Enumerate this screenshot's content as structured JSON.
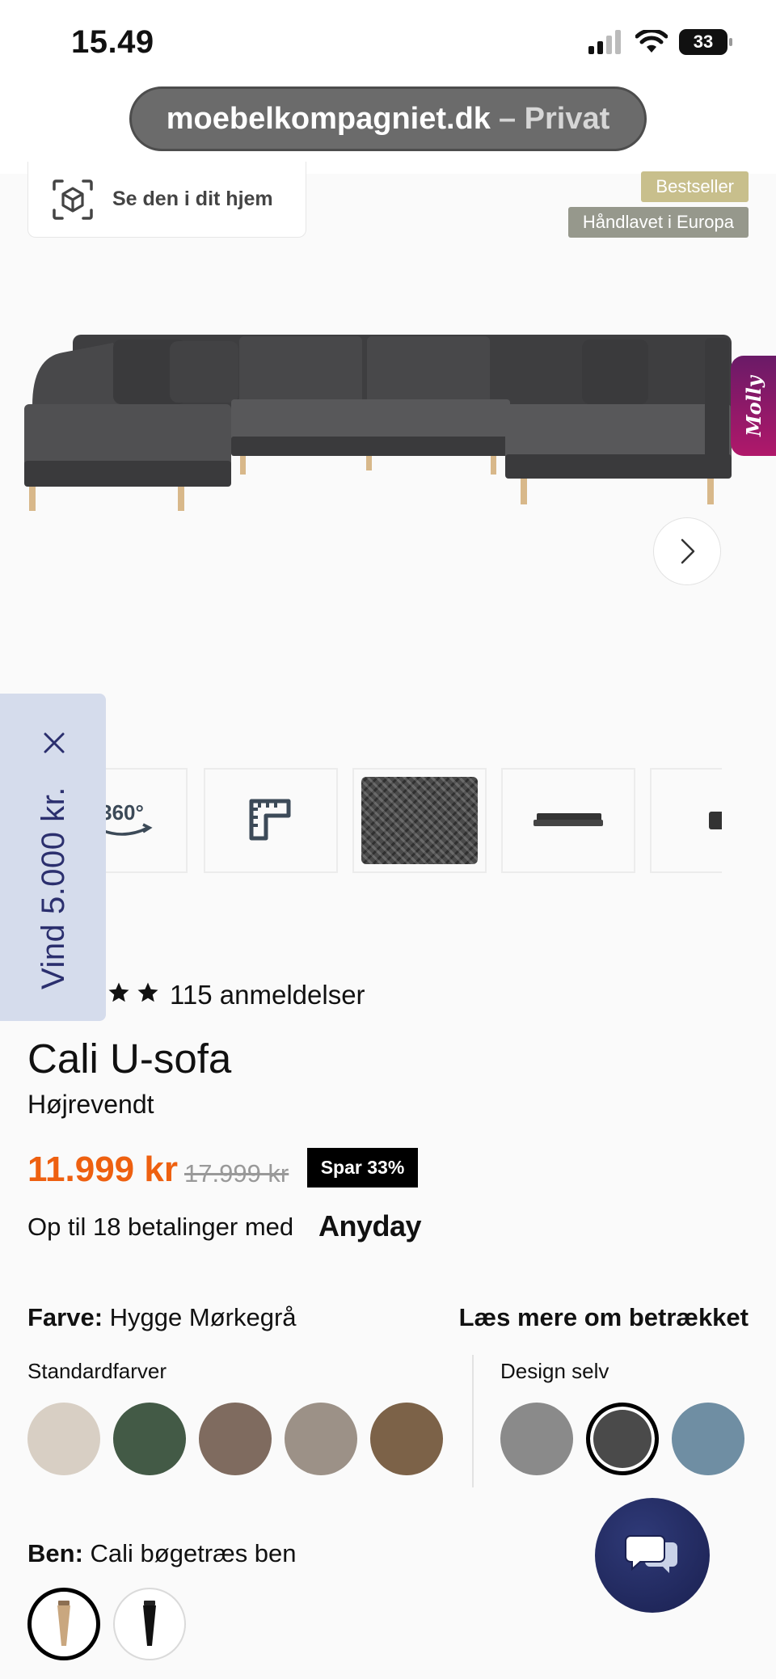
{
  "status_bar": {
    "time": "15.49",
    "battery": "33"
  },
  "browser": {
    "domain": "moebelkompagniet.dk",
    "mode": "– Privat"
  },
  "ar_button": {
    "label": "Se den i dit hjem"
  },
  "badges": {
    "bestseller": "Bestseller",
    "handmade": "Håndlavet i Europa"
  },
  "assistant_tab": {
    "label": "Molly"
  },
  "promo": {
    "label": "Vind 5.000 kr."
  },
  "thumbnails": {
    "rotate_label": "360°"
  },
  "product": {
    "review_count": "115 anmeldelser",
    "title": "Cali U-sofa",
    "variant": "Højrevendt",
    "price": "11.999 kr",
    "old_price": "17.999 kr",
    "save": "Spar 33%",
    "financing": "Op til 18 betalinger med",
    "financing_brand": "Anyday"
  },
  "color": {
    "label": "Farve:",
    "value": "Hygge Mørkegrå",
    "read_more": "Læs mere om betrækket",
    "standard_label": "Standardfarver",
    "custom_label": "Design selv",
    "standard_swatches": [
      "#d8cfc4",
      "#435a46",
      "#7f6b5f",
      "#9c9187",
      "#7c6248"
    ],
    "custom_swatches": [
      "#8a8a8a",
      "#4a4a4a",
      "#6f8ea3"
    ],
    "selected_custom_index": 1
  },
  "legs": {
    "label": "Ben:",
    "value": "Cali bøgetræs ben"
  },
  "colors": {
    "price_orange": "#ee6010",
    "sofa_gray": "#4a4a4c",
    "promo_bg": "#d5dcec",
    "promo_text": "#2b2f6e"
  }
}
